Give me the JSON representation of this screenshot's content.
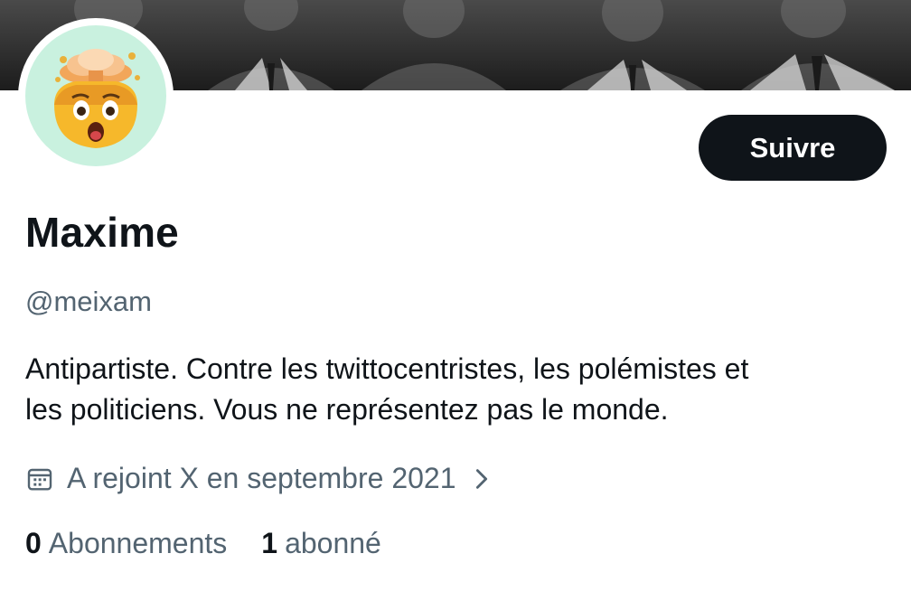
{
  "profile": {
    "name": "Maxime",
    "handle": "@meixam",
    "bio_line1": "Antipartiste. Contre les twittocentristes, les polémistes et",
    "bio_line2": "les politiciens. Vous ne représentez pas le monde.",
    "joined": "A rejoint X en septembre 2021",
    "avatar_icon": "exploding-head-emoji",
    "banner": "vintage black-and-white class photo"
  },
  "actions": {
    "follow_label": "Suivre"
  },
  "stats": {
    "following_count": "0",
    "following_label": "Abonnements",
    "followers_count": "1",
    "followers_label": "abonné"
  },
  "colors": {
    "text_primary": "#0f1419",
    "text_secondary": "#536471",
    "button_bg": "#0f1419",
    "avatar_bg": "#c9f1df"
  }
}
